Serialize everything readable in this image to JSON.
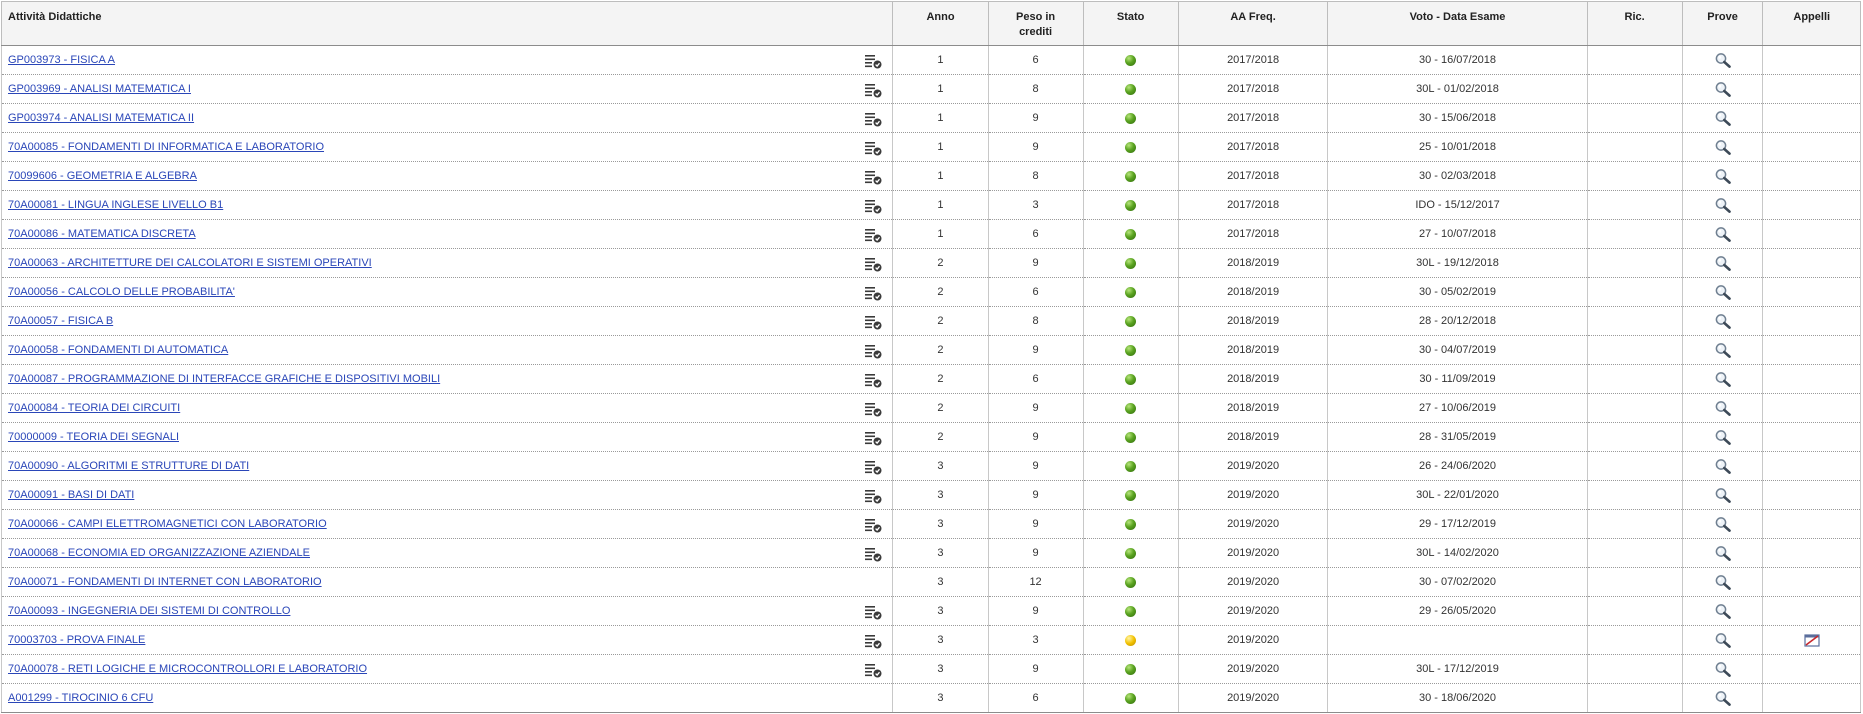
{
  "table": {
    "headers": {
      "attivita": "Attività Didattiche",
      "anno": "Anno",
      "peso_line1": "Peso in",
      "peso_line2": "crediti",
      "stato": "Stato",
      "aa_freq": "AA Freq.",
      "voto": "Voto - Data Esame",
      "ric": "Ric.",
      "prove": "Prove",
      "appelli": "Appelli"
    },
    "rows": [
      {
        "course": "GP003973 - FISICA A",
        "anno": "1",
        "crediti": "6",
        "stato": "green",
        "aa": "2017/2018",
        "voto": "30 - 16/07/2018",
        "detail_icon": true,
        "appelli_icon": false
      },
      {
        "course": "GP003969 - ANALISI MATEMATICA I",
        "anno": "1",
        "crediti": "8",
        "stato": "green",
        "aa": "2017/2018",
        "voto": "30L - 01/02/2018",
        "detail_icon": true,
        "appelli_icon": false
      },
      {
        "course": "GP003974 - ANALISI MATEMATICA II",
        "anno": "1",
        "crediti": "9",
        "stato": "green",
        "aa": "2017/2018",
        "voto": "30 - 15/06/2018",
        "detail_icon": true,
        "appelli_icon": false
      },
      {
        "course": "70A00085 - FONDAMENTI DI INFORMATICA E LABORATORIO",
        "anno": "1",
        "crediti": "9",
        "stato": "green",
        "aa": "2017/2018",
        "voto": "25 - 10/01/2018",
        "detail_icon": true,
        "appelli_icon": false
      },
      {
        "course": "70099606 - GEOMETRIA E ALGEBRA",
        "anno": "1",
        "crediti": "8",
        "stato": "green",
        "aa": "2017/2018",
        "voto": "30 - 02/03/2018",
        "detail_icon": true,
        "appelli_icon": false
      },
      {
        "course": "70A00081 - LINGUA INGLESE LIVELLO B1",
        "anno": "1",
        "crediti": "3",
        "stato": "green",
        "aa": "2017/2018",
        "voto": "IDO - 15/12/2017",
        "detail_icon": true,
        "appelli_icon": false
      },
      {
        "course": "70A00086 - MATEMATICA DISCRETA",
        "anno": "1",
        "crediti": "6",
        "stato": "green",
        "aa": "2017/2018",
        "voto": "27 - 10/07/2018",
        "detail_icon": true,
        "appelli_icon": false
      },
      {
        "course": "70A00063 - ARCHITETTURE DEI CALCOLATORI E SISTEMI OPERATIVI",
        "anno": "2",
        "crediti": "9",
        "stato": "green",
        "aa": "2018/2019",
        "voto": "30L - 19/12/2018",
        "detail_icon": true,
        "appelli_icon": false
      },
      {
        "course": "70A00056 - CALCOLO DELLE PROBABILITA'",
        "anno": "2",
        "crediti": "6",
        "stato": "green",
        "aa": "2018/2019",
        "voto": "30 - 05/02/2019",
        "detail_icon": true,
        "appelli_icon": false
      },
      {
        "course": "70A00057 - FISICA B",
        "anno": "2",
        "crediti": "8",
        "stato": "green",
        "aa": "2018/2019",
        "voto": "28 - 20/12/2018",
        "detail_icon": true,
        "appelli_icon": false
      },
      {
        "course": "70A00058 - FONDAMENTI DI AUTOMATICA",
        "anno": "2",
        "crediti": "9",
        "stato": "green",
        "aa": "2018/2019",
        "voto": "30 - 04/07/2019",
        "detail_icon": true,
        "appelli_icon": false
      },
      {
        "course": "70A00087 - PROGRAMMAZIONE DI INTERFACCE GRAFICHE E DISPOSITIVI MOBILI",
        "anno": "2",
        "crediti": "6",
        "stato": "green",
        "aa": "2018/2019",
        "voto": "30 - 11/09/2019",
        "detail_icon": true,
        "appelli_icon": false
      },
      {
        "course": "70A00084 - TEORIA DEI CIRCUITI",
        "anno": "2",
        "crediti": "9",
        "stato": "green",
        "aa": "2018/2019",
        "voto": "27 - 10/06/2019",
        "detail_icon": true,
        "appelli_icon": false
      },
      {
        "course": "70000009 - TEORIA DEI SEGNALI",
        "anno": "2",
        "crediti": "9",
        "stato": "green",
        "aa": "2018/2019",
        "voto": "28 - 31/05/2019",
        "detail_icon": true,
        "appelli_icon": false
      },
      {
        "course": "70A00090 - ALGORITMI E STRUTTURE DI DATI",
        "anno": "3",
        "crediti": "9",
        "stato": "green",
        "aa": "2019/2020",
        "voto": "26 - 24/06/2020",
        "detail_icon": true,
        "appelli_icon": false
      },
      {
        "course": "70A00091 - BASI DI DATI",
        "anno": "3",
        "crediti": "9",
        "stato": "green",
        "aa": "2019/2020",
        "voto": "30L - 22/01/2020",
        "detail_icon": true,
        "appelli_icon": false
      },
      {
        "course": "70A00066 - CAMPI ELETTROMAGNETICI CON LABORATORIO",
        "anno": "3",
        "crediti": "9",
        "stato": "green",
        "aa": "2019/2020",
        "voto": "29 - 17/12/2019",
        "detail_icon": true,
        "appelli_icon": false
      },
      {
        "course": "70A00068 - ECONOMIA ED ORGANIZZAZIONE AZIENDALE",
        "anno": "3",
        "crediti": "9",
        "stato": "green",
        "aa": "2019/2020",
        "voto": "30L - 14/02/2020",
        "detail_icon": true,
        "appelli_icon": false
      },
      {
        "course": "70A00071 - FONDAMENTI DI INTERNET CON LABORATORIO",
        "anno": "3",
        "crediti": "12",
        "stato": "green",
        "aa": "2019/2020",
        "voto": "30 - 07/02/2020",
        "detail_icon": false,
        "appelli_icon": false
      },
      {
        "course": "70A00093 - INGEGNERIA DEI SISTEMI DI CONTROLLO",
        "anno": "3",
        "crediti": "9",
        "stato": "green",
        "aa": "2019/2020",
        "voto": "29 - 26/05/2020",
        "detail_icon": true,
        "appelli_icon": false
      },
      {
        "course": "70003703 - PROVA FINALE",
        "anno": "3",
        "crediti": "3",
        "stato": "yellow",
        "aa": "2019/2020",
        "voto": "",
        "detail_icon": true,
        "appelli_icon": true
      },
      {
        "course": "70A00078 - RETI LOGICHE E MICROCONTROLLORI E LABORATORIO",
        "anno": "3",
        "crediti": "9",
        "stato": "green",
        "aa": "2019/2020",
        "voto": "30L - 17/12/2019",
        "detail_icon": true,
        "appelli_icon": false
      },
      {
        "course": "A001299 - TIROCINIO 6 CFU",
        "anno": "3",
        "crediti": "6",
        "stato": "green",
        "aa": "2019/2020",
        "voto": "30 - 18/06/2020",
        "detail_icon": false,
        "appelli_icon": false
      }
    ]
  },
  "icons": {
    "detail": "list-check-icon",
    "prove": "magnifier-icon",
    "appelli": "calendar-blocked-icon",
    "stato_green": "status-green-dot-icon",
    "stato_yellow": "status-yellow-dot-icon"
  },
  "colors": {
    "link": "#2a46b8",
    "header_bg": "#f4f4f4",
    "status_green": "#5aa320",
    "status_yellow": "#f2c100"
  }
}
